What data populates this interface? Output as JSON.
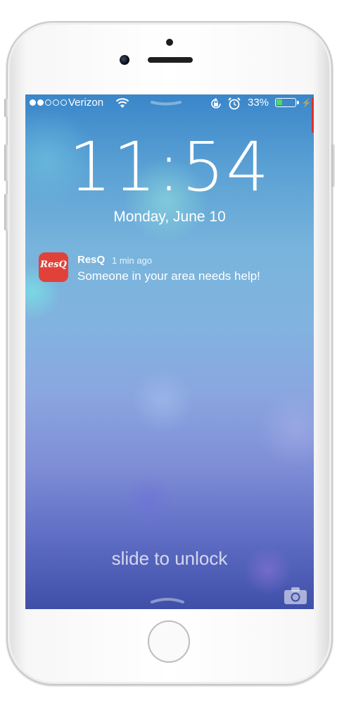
{
  "status_bar": {
    "carrier": "Verizon",
    "signal_bars": 2,
    "battery_percent": "33%",
    "battery_level": 0.33,
    "icons": [
      "wifi-icon",
      "rotation-lock-icon",
      "alarm-icon",
      "battery-icon",
      "charging-bolt-icon"
    ]
  },
  "lock_screen": {
    "time": "11:54",
    "date": "Monday, June 10",
    "slide_to_unlock": "slide to unlock"
  },
  "notification": {
    "app_name": "ResQ",
    "time_ago": "1 min ago",
    "message": "Someone in your area needs help!",
    "icon_text": "ResQ",
    "icon_color": "#e0423a"
  },
  "colors": {
    "battery_fill": "#4cd964",
    "screen_top": "#3a86c9",
    "screen_bottom": "#3f4fa8"
  }
}
